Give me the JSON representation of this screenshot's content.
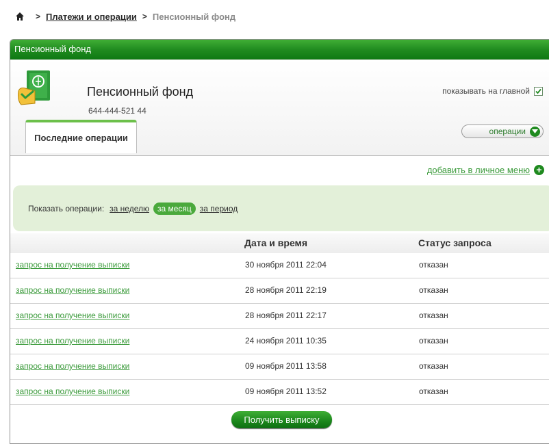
{
  "breadcrumb": {
    "link": "Платежи и операции",
    "current": "Пенсионный фонд"
  },
  "panel": {
    "header_title": "Пенсионный фонд"
  },
  "account": {
    "title": "Пенсионный фонд",
    "number": "644-444-521 44",
    "show_on_main_label": "показывать на главной",
    "show_on_main_checked": true,
    "operations_button": "операции"
  },
  "tabs": [
    {
      "label": "Последние операции",
      "active": true
    }
  ],
  "add_menu_link": "добавить в личное меню",
  "filter": {
    "label": "Показать операции:",
    "options": [
      {
        "label": "за неделю",
        "active": false
      },
      {
        "label": "за месяц",
        "active": true
      },
      {
        "label": "за период",
        "active": false
      }
    ]
  },
  "table": {
    "columns": [
      "",
      "Дата и время",
      "Статус запроса"
    ],
    "rows": [
      {
        "name": "запрос на получение выписки",
        "datetime": "30 ноября 2011  22:04",
        "status": "отказан"
      },
      {
        "name": "запрос на получение выписки",
        "datetime": "28 ноября 2011  22:19",
        "status": "отказан"
      },
      {
        "name": "запрос на получение выписки",
        "datetime": "28 ноября 2011  22:17",
        "status": "отказан"
      },
      {
        "name": "запрос на получение выписки",
        "datetime": "24 ноября 2011  10:35",
        "status": "отказан"
      },
      {
        "name": "запрос на получение выписки",
        "datetime": "09 ноября 2011  13:58",
        "status": "отказан"
      },
      {
        "name": "запрос на получение выписки",
        "datetime": "09 ноября 2011  13:52",
        "status": "отказан"
      }
    ]
  },
  "get_statement_button": "Получить выписку",
  "colors": {
    "brand_green": "#1f8a1f",
    "link_green": "#3a9a3a",
    "filter_bg": "#e3f0d9"
  }
}
